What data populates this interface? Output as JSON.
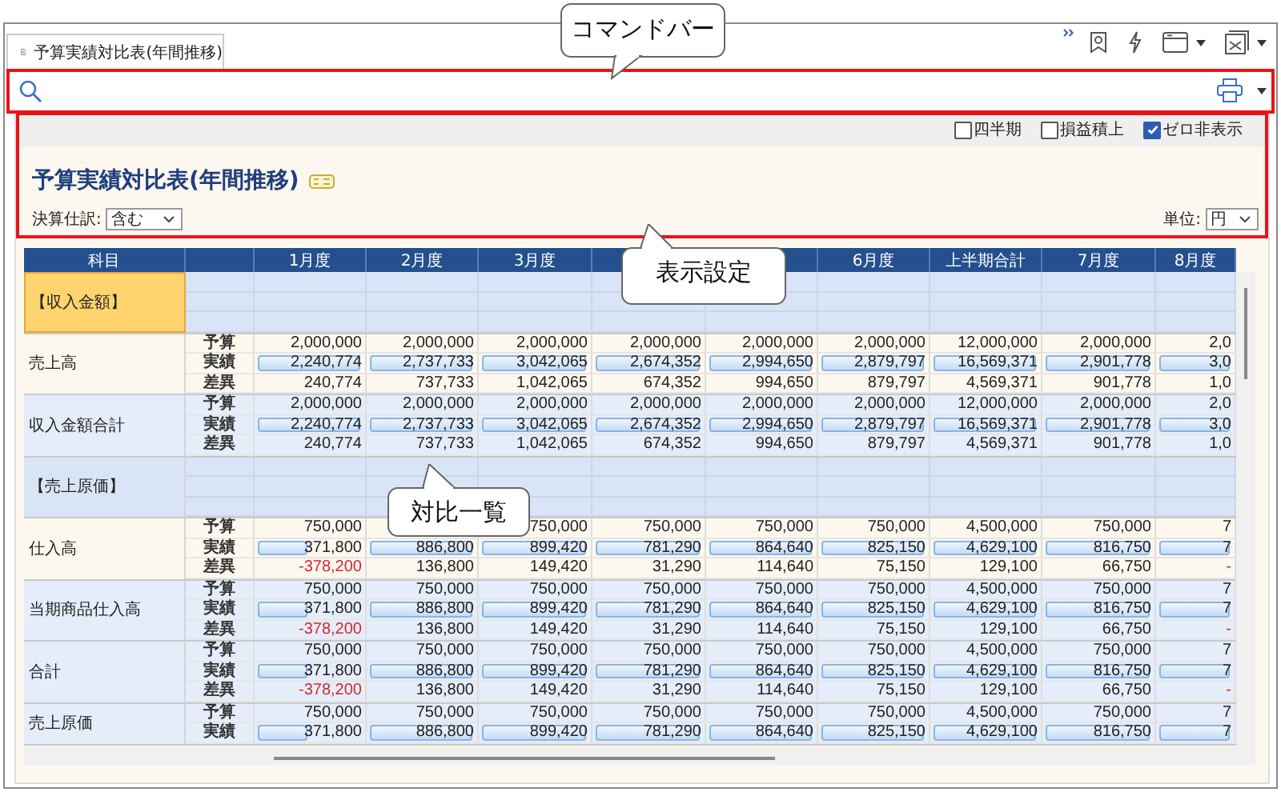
{
  "tab": {
    "title": "予算実績対比表(年間推移)"
  },
  "options": [
    {
      "label": "四半期",
      "checked": false
    },
    {
      "label": "損益積上",
      "checked": false
    },
    {
      "label": "ゼロ非表示",
      "checked": true
    }
  ],
  "report": {
    "title": "予算実績対比表(年間推移)",
    "filter": {
      "label": "決算仕訳:",
      "value": "含む"
    },
    "unit": {
      "label": "単位:",
      "value": "円"
    }
  },
  "table": {
    "columns": [
      {
        "label": "科目"
      },
      {},
      {
        "label": "1月度"
      },
      {
        "label": "2月度"
      },
      {
        "label": "3月度"
      },
      {},
      {},
      {
        "label": "6月度"
      },
      {
        "label": "上半期合計"
      },
      {
        "label": "7月度"
      },
      {
        "label": "8月度"
      }
    ],
    "groups": [
      {
        "kind": "heading",
        "label": "【収入金額】",
        "selected": true
      },
      {
        "kind": "account",
        "label": "売上高",
        "lines": [
          {
            "label": "予算",
            "cells": [
              "2,000,000",
              "2,000,000",
              "2,000,000",
              "2,000,000",
              "2,000,000",
              "2,000,000",
              "12,000,000",
              "2,000,000",
              "2,0"
            ]
          },
          {
            "label": "実績",
            "cells": [
              {
                "text": "2,240,774",
                "level": 1
              },
              {
                "text": "2,737,733",
                "level": 1
              },
              {
                "text": "3,042,065",
                "level": 1
              },
              {
                "text": "2,674,352",
                "level": 1
              },
              {
                "text": "2,994,650",
                "level": 1
              },
              {
                "text": "2,879,797",
                "level": 1
              },
              {
                "text": "16,569,371",
                "level": 1
              },
              {
                "text": "2,901,778",
                "level": 1
              },
              {
                "text": "3,0",
                "level": 1
              }
            ]
          },
          {
            "label": "差異",
            "cells": [
              "240,774",
              "737,733",
              "1,042,065",
              "674,352",
              "994,650",
              "879,797",
              "4,569,371",
              "901,778",
              "1,0"
            ]
          }
        ]
      },
      {
        "kind": "subtotal",
        "label": "収入金額合計",
        "lines": [
          {
            "label": "予算",
            "cells": [
              "2,000,000",
              "2,000,000",
              "2,000,000",
              "2,000,000",
              "2,000,000",
              "2,000,000",
              "12,000,000",
              "2,000,000",
              "2,0"
            ]
          },
          {
            "label": "実績",
            "cells": [
              {
                "text": "2,240,774",
                "level": 1
              },
              {
                "text": "2,737,733",
                "level": 1
              },
              {
                "text": "3,042,065",
                "level": 1
              },
              {
                "text": "2,674,352",
                "level": 1
              },
              {
                "text": "2,994,650",
                "level": 1
              },
              {
                "text": "2,879,797",
                "level": 1
              },
              {
                "text": "16,569,371",
                "level": 1
              },
              {
                "text": "2,901,778",
                "level": 1
              },
              {
                "text": "3,0",
                "level": 1
              }
            ]
          },
          {
            "label": "差異",
            "cells": [
              "240,774",
              "737,733",
              "1,042,065",
              "674,352",
              "994,650",
              "879,797",
              "4,569,371",
              "901,778",
              "1,0"
            ]
          }
        ]
      },
      {
        "kind": "heading",
        "label": "【売上原価】",
        "selected": false
      },
      {
        "kind": "account",
        "label": "仕入高",
        "lines": [
          {
            "label": "予算",
            "cells": [
              "750,000",
              null,
              "750,000",
              "750,000",
              "750,000",
              "750,000",
              "4,500,000",
              "750,000",
              "7"
            ]
          },
          {
            "label": "実績",
            "cells": [
              {
                "text": "371,800",
                "level": 0.48
              },
              {
                "text": "886,800",
                "level": 1
              },
              {
                "text": "899,420",
                "level": 1
              },
              {
                "text": "781,290",
                "level": 1
              },
              {
                "text": "864,640",
                "level": 1
              },
              {
                "text": "825,150",
                "level": 1
              },
              {
                "text": "4,629,100",
                "level": 1
              },
              {
                "text": "816,750",
                "level": 1
              },
              {
                "text": "7",
                "level": 1
              }
            ]
          },
          {
            "label": "差異",
            "cells": [
              {
                "text": "-378,200",
                "negative": true
              },
              "136,800",
              "149,420",
              "31,290",
              "114,640",
              "75,150",
              "129,100",
              "66,750",
              {
                "text": "-",
                "negative": true
              }
            ]
          }
        ]
      },
      {
        "kind": "subtotal",
        "label": "当期商品仕入高",
        "lines": [
          {
            "label": "予算",
            "cells": [
              "750,000",
              "750,000",
              "750,000",
              "750,000",
              "750,000",
              "750,000",
              "4,500,000",
              "750,000",
              "7"
            ]
          },
          {
            "label": "実績",
            "cells": [
              {
                "text": "371,800",
                "level": 0.48
              },
              {
                "text": "886,800",
                "level": 1
              },
              {
                "text": "899,420",
                "level": 1
              },
              {
                "text": "781,290",
                "level": 1
              },
              {
                "text": "864,640",
                "level": 1
              },
              {
                "text": "825,150",
                "level": 1
              },
              {
                "text": "4,629,100",
                "level": 1
              },
              {
                "text": "816,750",
                "level": 1
              },
              {
                "text": "7",
                "level": 1
              }
            ]
          },
          {
            "label": "差異",
            "cells": [
              {
                "text": "-378,200",
                "negative": true
              },
              "136,800",
              "149,420",
              "31,290",
              "114,640",
              "75,150",
              "129,100",
              "66,750",
              {
                "text": "-",
                "negative": true
              }
            ]
          }
        ]
      },
      {
        "kind": "subtotal",
        "label": "合計",
        "lines": [
          {
            "label": "予算",
            "cells": [
              "750,000",
              "750,000",
              "750,000",
              "750,000",
              "750,000",
              "750,000",
              "4,500,000",
              "750,000",
              "7"
            ]
          },
          {
            "label": "実績",
            "cells": [
              {
                "text": "371,800",
                "level": 0.48
              },
              {
                "text": "886,800",
                "level": 1
              },
              {
                "text": "899,420",
                "level": 1
              },
              {
                "text": "781,290",
                "level": 1
              },
              {
                "text": "864,640",
                "level": 1
              },
              {
                "text": "825,150",
                "level": 1
              },
              {
                "text": "4,629,100",
                "level": 1
              },
              {
                "text": "816,750",
                "level": 1
              },
              {
                "text": "7",
                "level": 1
              }
            ]
          },
          {
            "label": "差異",
            "cells": [
              {
                "text": "-378,200",
                "negative": true
              },
              "136,800",
              "149,420",
              "31,290",
              "114,640",
              "75,150",
              "129,100",
              "66,750",
              {
                "text": "-",
                "negative": true
              }
            ]
          }
        ]
      },
      {
        "kind": "subtotal",
        "label": "売上原価",
        "lines": [
          {
            "label": "予算",
            "cells": [
              "750,000",
              "750,000",
              "750,000",
              "750,000",
              "750,000",
              "750,000",
              "4,500,000",
              "750,000",
              "7"
            ]
          },
          {
            "label": "実績",
            "cells": [
              {
                "text": "371,800",
                "level": 0.48
              },
              {
                "text": "886,800",
                "level": 1
              },
              {
                "text": "899,420",
                "level": 1
              },
              {
                "text": "781,290",
                "level": 1
              },
              {
                "text": "864,640",
                "level": 1
              },
              {
                "text": "825,150",
                "level": 1
              },
              {
                "text": "4,629,100",
                "level": 1
              },
              {
                "text": "816,750",
                "level": 1
              },
              {
                "text": "7",
                "level": 1
              }
            ]
          }
        ]
      }
    ]
  },
  "callouts": [
    {
      "text": "コマンドバー"
    },
    {
      "text": "表示設定"
    },
    {
      "text": "対比一覧"
    }
  ]
}
